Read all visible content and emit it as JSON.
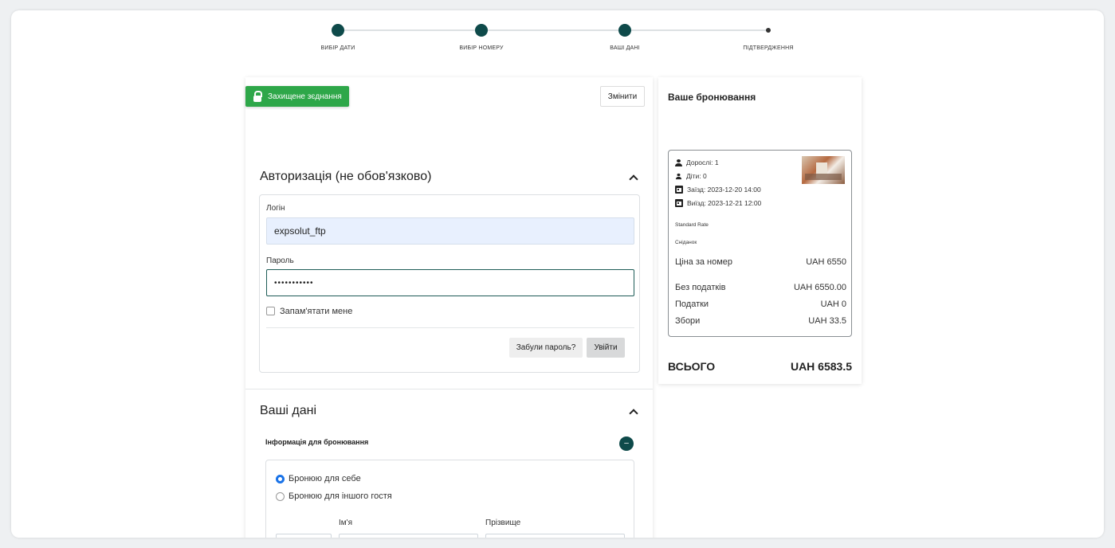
{
  "stepper": {
    "steps": [
      {
        "label": "ВИБІР ДАТИ"
      },
      {
        "label": "ВИБІР НОМЕРУ"
      },
      {
        "label": "ВАШІ ДАНІ"
      },
      {
        "label": "ПІДТВЕРДЖЕННЯ"
      }
    ]
  },
  "secure_badge": "Захищене зєднання",
  "change_button": "Змінити",
  "auth": {
    "title": "Авторизація (не обов'язково)",
    "login_label": "Логін",
    "login_value": "expsolut_ftp",
    "password_label": "Пароль",
    "password_value": "•••••••••••",
    "remember_label": "Запам'ятати мене",
    "forgot_button": "Забули пароль?",
    "login_button": "Увійти"
  },
  "your_data": {
    "title": "Ваші дані",
    "booking_info": "Інформація для бронювання",
    "minus": "–",
    "radio_self": "Бронюю для себе",
    "radio_other": "Бронюю для іншого гостя",
    "first_name_label": "Ім'я",
    "last_name_label": "Прізвище"
  },
  "booking": {
    "title": "Ваше бронювання",
    "adults": "Дорослі: 1",
    "children": "Діти: 0",
    "checkin": "Заїзд: 2023-12-20 14:00",
    "checkout": "Виїзд: 2023-12-21 12:00",
    "rate": "Standard Rate",
    "meal": "Сніданок",
    "rows": [
      {
        "label": "Ціна за номер",
        "value": "UAH 6550"
      },
      {
        "label": "Без податків",
        "value": "UAH 6550.00"
      },
      {
        "label": "Податки",
        "value": "UAH 0"
      },
      {
        "label": "Збори",
        "value": "UAH 33.5"
      }
    ],
    "total_label": "ВСЬОГО",
    "total_value": "UAH 6583.5"
  },
  "colors": {
    "accent": "#0e4a4a",
    "secure_green": "#2ea749",
    "radio_blue": "#1a73e8"
  }
}
